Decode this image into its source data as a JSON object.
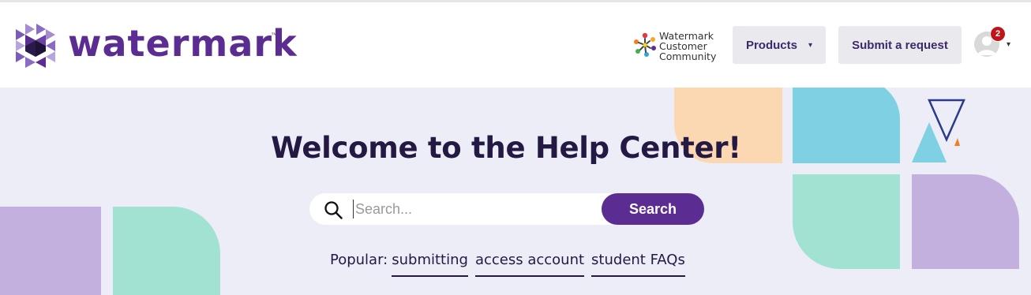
{
  "header": {
    "logo_text": "watermark",
    "logo_tm": "™",
    "community": [
      "Watermark",
      "Customer",
      "Community"
    ],
    "products_label": "Products",
    "submit_label": "Submit a request",
    "notification_count": "2"
  },
  "hero": {
    "title": "Welcome to the Help Center!",
    "search": {
      "placeholder": "Search...",
      "button_label": "Search"
    },
    "popular": {
      "label": "Popular:",
      "links": [
        "submitting",
        "access account",
        "student FAQs"
      ]
    }
  },
  "colors": {
    "brand": "#5b2c91",
    "hero_bg": "#ecedf7",
    "peach": "#fbd8b2",
    "sky": "#7ed0e2",
    "mint": "#a1e2d2",
    "lavender": "#c3b0de",
    "badge": "#c0141b"
  },
  "icons": {
    "search": "search-icon",
    "chevron": "chevron-down-icon",
    "avatar": "user-avatar-icon"
  }
}
